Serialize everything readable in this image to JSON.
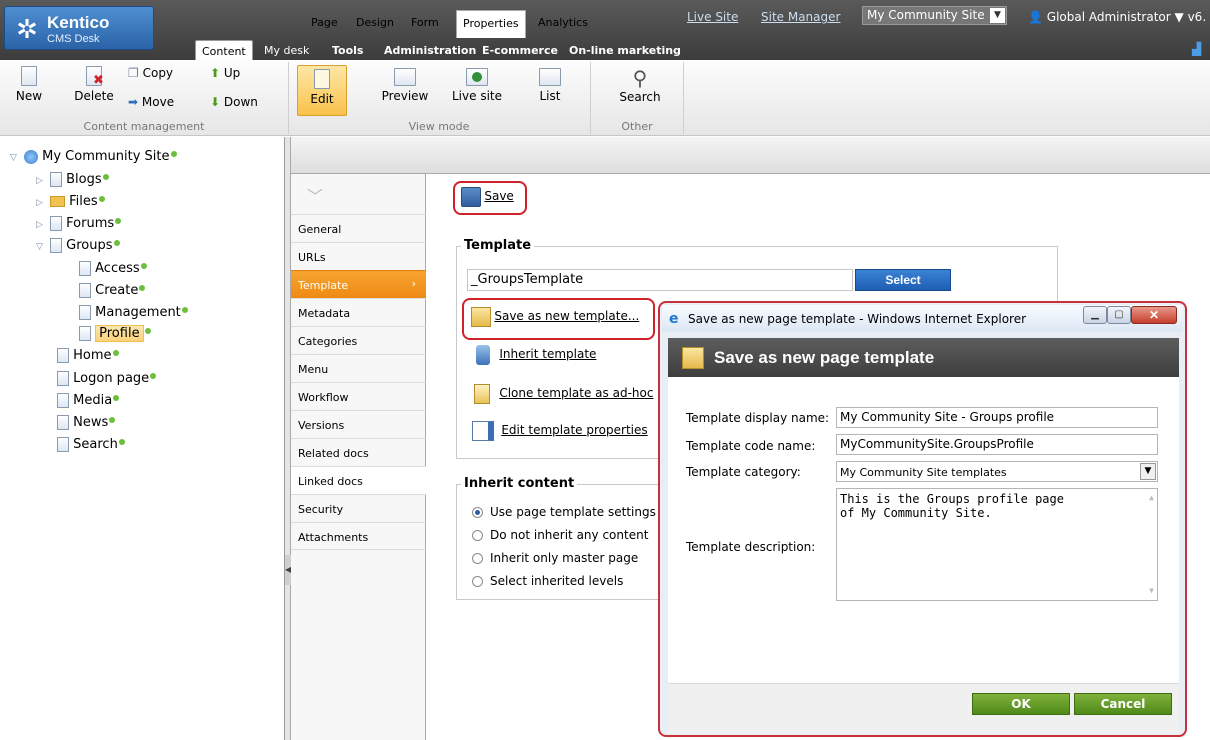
{
  "header": {
    "logo_title": "Kentico",
    "logo_subtitle": "CMS Desk",
    "links": [
      "Live Site",
      "Site Manager"
    ],
    "site_selector": "My Community Site",
    "user": "Global Administrator",
    "version": "v6.",
    "main_tabs": [
      "Content",
      "My desk",
      "Tools",
      "Administration",
      "E-commerce",
      "On-line marketing"
    ]
  },
  "ribbon": {
    "content_mgmt": {
      "new": "New",
      "delete": "Delete",
      "copy": "Copy",
      "move": "Move",
      "up": "Up",
      "down": "Down",
      "title": "Content management"
    },
    "view_mode": {
      "edit": "Edit",
      "preview": "Preview",
      "live": "Live site",
      "list": "List",
      "title": "View mode"
    },
    "other": {
      "search": "Search",
      "title": "Other"
    }
  },
  "tree": {
    "root": "My Community Site",
    "items": [
      "Blogs",
      "Files",
      "Forums",
      "Groups",
      "Access",
      "Create",
      "Management",
      "Profile",
      "Home",
      "Logon page",
      "Media",
      "News",
      "Search"
    ]
  },
  "page_tabs": [
    "Page",
    "Design",
    "Form",
    "Properties",
    "Analytics"
  ],
  "menu": [
    "General",
    "URLs",
    "Template",
    "Metadata",
    "Categories",
    "Menu",
    "Workflow",
    "Versions",
    "Related docs",
    "Linked docs",
    "Security",
    "Attachments"
  ],
  "content": {
    "save": "Save",
    "template_legend": "Template",
    "template_value": "_GroupsTemplate",
    "select_button": "Select",
    "actions": [
      "Save as new template...",
      "Inherit template",
      "Clone template as ad-hoc",
      "Edit template properties"
    ],
    "inherit_legend": "Inherit content",
    "inherit_options": [
      "Use page template settings",
      "Do not inherit any content",
      "Inherit only master page",
      "Select inherited levels"
    ]
  },
  "dialog": {
    "window_title": "Save as new page template - Windows Internet Explorer",
    "heading": "Save as new page template",
    "labels": {
      "display_name": "Template display name:",
      "code_name": "Template code name:",
      "category": "Template category:",
      "description": "Template description:"
    },
    "values": {
      "display_name": "My Community Site - Groups profile",
      "code_name": "MyCommunitySite.GroupsProfile",
      "category": "My Community Site templates",
      "description_line1": "This is the Groups profile page",
      "description_line2": "of My Community Site."
    },
    "ok": "OK",
    "cancel": "Cancel"
  },
  "colors": {
    "accent": "#ee8a14",
    "selected_node": "#fbd27a",
    "green_button": "#5f9a24",
    "highlight": "#d0202a"
  }
}
